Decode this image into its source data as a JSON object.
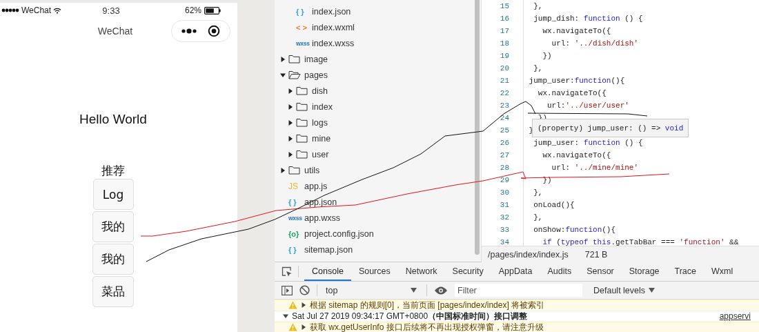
{
  "phone": {
    "status_bar": {
      "carrier": "WeChat",
      "time": "9:33",
      "battery": "62%"
    },
    "nav_title": "WeChat",
    "hello": "Hello World",
    "section_label": "推荐",
    "buttons": [
      "Log",
      "我的",
      "我的",
      "菜品"
    ]
  },
  "file_tree": {
    "cut_off_files": [
      {
        "name": "index.json",
        "icon": "{ }",
        "kind": "json"
      },
      {
        "name": "index.wxml",
        "icon": "< >",
        "kind": "wxml"
      },
      {
        "name": "index.wxss",
        "icon": "wxss",
        "kind": "wxss"
      }
    ],
    "items": [
      {
        "name": "image",
        "kind": "folder",
        "expanded": false
      },
      {
        "name": "pages",
        "kind": "folder",
        "expanded": true,
        "children": [
          {
            "name": "dish",
            "kind": "folder",
            "expanded": false
          },
          {
            "name": "index",
            "kind": "folder",
            "expanded": false
          },
          {
            "name": "logs",
            "kind": "folder",
            "expanded": false
          },
          {
            "name": "mine",
            "kind": "folder",
            "expanded": false
          },
          {
            "name": "user",
            "kind": "folder",
            "expanded": false
          }
        ]
      },
      {
        "name": "utils",
        "kind": "folder",
        "expanded": false
      },
      {
        "name": "app.js",
        "kind": "js",
        "icon": "JS"
      },
      {
        "name": "app.json",
        "kind": "json",
        "icon": "{ }"
      },
      {
        "name": "app.wxss",
        "kind": "wxss",
        "icon": "wxss"
      },
      {
        "name": "project.config.json",
        "kind": "config",
        "icon": "{o}"
      },
      {
        "name": "sitemap.json",
        "kind": "json",
        "icon": "{ }"
      }
    ]
  },
  "editor": {
    "lines": [
      {
        "n": "15",
        "tokens": [
          {
            "t": "  },",
            "kind": "plain"
          }
        ]
      },
      {
        "n": "16",
        "tokens": [
          {
            "t": "  jump_dish: ",
            "kind": "plain"
          },
          {
            "t": "function",
            "kind": "keyword"
          },
          {
            "t": " () {",
            "kind": "plain"
          }
        ]
      },
      {
        "n": "17",
        "tokens": [
          {
            "t": "    wx.navigateTo({",
            "kind": "plain"
          }
        ]
      },
      {
        "n": "18",
        "tokens": [
          {
            "t": "      url: ",
            "kind": "plain"
          },
          {
            "t": "'../dish/dish'",
            "kind": "string"
          }
        ]
      },
      {
        "n": "19",
        "tokens": [
          {
            "t": "    })",
            "kind": "plain"
          }
        ]
      },
      {
        "n": "20",
        "tokens": [
          {
            "t": "  },",
            "kind": "plain"
          }
        ]
      },
      {
        "n": "21",
        "tokens": [
          {
            "t": " jump_user:",
            "kind": "plain"
          },
          {
            "t": "function",
            "kind": "keyword"
          },
          {
            "t": "(){",
            "kind": "plain"
          }
        ]
      },
      {
        "n": "22",
        "tokens": [
          {
            "t": "   wx.navigateTo({",
            "kind": "plain"
          }
        ]
      },
      {
        "n": "23",
        "tokens": [
          {
            "t": "     url:",
            "kind": "plain"
          },
          {
            "t": "'../user/user'",
            "kind": "string"
          }
        ]
      },
      {
        "n": "24",
        "tokens": [
          {
            "t": "   })",
            "kind": "plain"
          }
        ]
      },
      {
        "n": "25",
        "tokens": [
          {
            "t": " }",
            "kind": "plain"
          }
        ]
      },
      {
        "n": "26",
        "tokens": [
          {
            "t": "  jump_user: ",
            "kind": "plain"
          },
          {
            "t": "function",
            "kind": "keyword"
          },
          {
            "t": " () {",
            "kind": "plain"
          }
        ]
      },
      {
        "n": "27",
        "tokens": [
          {
            "t": "    wx.navigateTo({",
            "kind": "plain"
          }
        ]
      },
      {
        "n": "28",
        "tokens": [
          {
            "t": "      url: ",
            "kind": "plain"
          },
          {
            "t": "'../mine/mine'",
            "kind": "string"
          }
        ]
      },
      {
        "n": "29",
        "tokens": [
          {
            "t": "    })",
            "kind": "plain"
          }
        ]
      },
      {
        "n": "30",
        "tokens": [
          {
            "t": "  },",
            "kind": "plain"
          }
        ]
      },
      {
        "n": "31",
        "tokens": [
          {
            "t": "  onLoad(){",
            "kind": "plain"
          }
        ]
      },
      {
        "n": "32",
        "tokens": [
          {
            "t": "  },",
            "kind": "plain"
          }
        ]
      },
      {
        "n": "33",
        "tokens": [
          {
            "t": "  onShow:",
            "kind": "plain"
          },
          {
            "t": "function",
            "kind": "keyword"
          },
          {
            "t": "(){",
            "kind": "plain"
          }
        ]
      },
      {
        "n": "34",
        "tokens": [
          {
            "t": "    if",
            "kind": "keyword"
          },
          {
            "t": " (",
            "kind": "plain"
          },
          {
            "t": "typeof this",
            "kind": "keyword"
          },
          {
            "t": ".getTabBar === ",
            "kind": "plain"
          },
          {
            "t": "'function'",
            "kind": "string"
          },
          {
            "t": " &&",
            "kind": "plain"
          }
        ]
      }
    ],
    "tooltip": [
      {
        "t": "(property) jump_user: () => ",
        "kind": "plain"
      },
      {
        "t": "void",
        "kind": "keyword"
      }
    ],
    "status": {
      "path": "/pages/index/index.js",
      "size": "721 B"
    }
  },
  "devtools": {
    "tabs": [
      {
        "label": "Console",
        "selected": true
      },
      {
        "label": "Sources",
        "selected": false
      },
      {
        "label": "Network",
        "selected": false
      },
      {
        "label": "Security",
        "selected": false
      },
      {
        "label": "AppData",
        "selected": false
      },
      {
        "label": "Audits",
        "selected": false
      },
      {
        "label": "Sensor",
        "selected": false
      },
      {
        "label": "Storage",
        "selected": false
      },
      {
        "label": "Trace",
        "selected": false
      },
      {
        "label": "Wxml",
        "selected": false
      }
    ],
    "context": "top",
    "filter": {
      "placeholder": "Filter"
    },
    "levels": "Default levels",
    "messages": [
      {
        "kind": "warning",
        "expanded": false,
        "text": "根据 sitemap 的规则[0]，当前页面 [pages/index/index] 将被索引"
      },
      {
        "kind": "group",
        "expanded": true,
        "text": "Sat Jul 27 2019 09:34:17 GMT+0800**（中国标准时间）接口调整**",
        "source": "appservi"
      },
      {
        "kind": "warning",
        "expanded": false,
        "text": "获取 wx.getUserInfo 接口后续将不再出现授权弹窗，请注意升级"
      }
    ]
  }
}
